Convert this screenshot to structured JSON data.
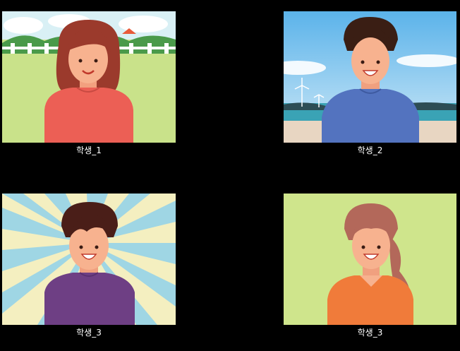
{
  "participants": [
    {
      "name": "학생_1"
    },
    {
      "name": "학생_2"
    },
    {
      "name": "학생_3"
    },
    {
      "name": "학생_3"
    }
  ]
}
